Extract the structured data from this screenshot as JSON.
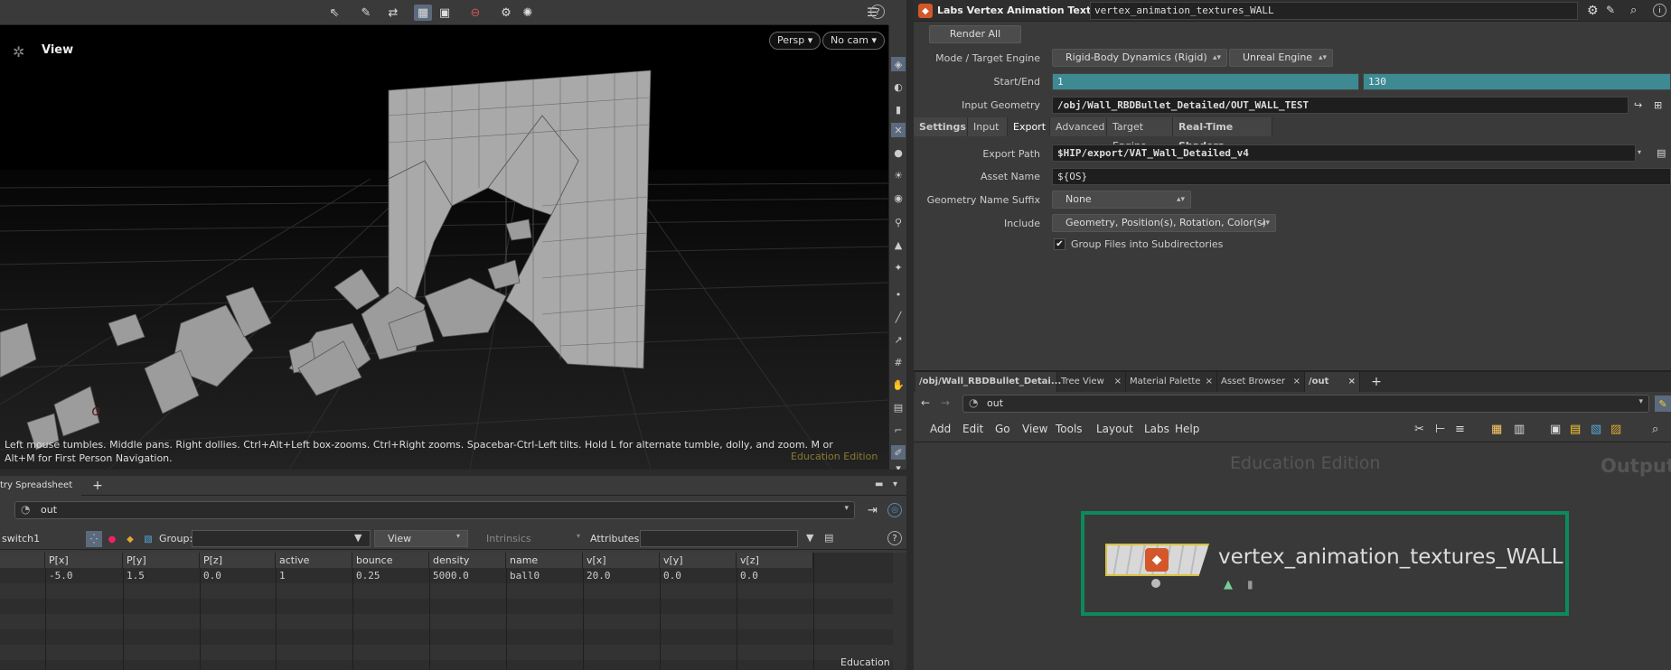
{
  "viewport": {
    "title": "View",
    "camera_persp": "Persp ▾",
    "camera_nocam": "No cam ▾",
    "hint": "Left mouse tumbles. Middle pans. Right dollies. Ctrl+Alt+Left box-zooms. Ctrl+Right zooms. Spacebar-Ctrl-Left tilts. Hold L for alternate tumble, dolly, and zoom. M or Alt+M for First Person Navigation.",
    "edition": "Education Edition",
    "help": "?"
  },
  "spreadsheet": {
    "tab_label": "try Spreadsheet",
    "add_tab": "+",
    "path": "out",
    "node": "switch1",
    "group_label": "Group:",
    "view_label": "View",
    "intrinsics_label": "Intrinsics",
    "attributes_label": "Attributes:",
    "edition": "Education",
    "columns": [
      "P[x]",
      "P[y]",
      "P[z]",
      "active",
      "bounce",
      "density",
      "name",
      "v[x]",
      "v[y]",
      "v[z]"
    ],
    "rows": [
      [
        "-5.0",
        "1.5",
        "0.0",
        "1",
        "0.25",
        "5000.0",
        "ball0",
        "20.0",
        "0.0",
        "0.0"
      ]
    ]
  },
  "params": {
    "node_type": "Labs Vertex Animation Textures",
    "node_name": "vertex_animation_textures_WALL",
    "render_all": "Render All",
    "mode_label": "Mode / Target Engine",
    "mode_value": "Rigid-Body Dynamics (Rigid)",
    "engine_value": "Unreal Engine",
    "startend_label": "Start/End",
    "start": "1",
    "end": "130",
    "input_geo_label": "Input Geometry",
    "input_geo": "/obj/Wall_RBDBullet_Detailed/OUT_WALL_TEST",
    "tabs": [
      "Settings",
      "Input",
      "Export",
      "Advanced",
      "Target Engine",
      "Real-Time Shaders"
    ],
    "export_path_label": "Export Path",
    "export_path": "$HIP/export/VAT_Wall_Detailed_v4",
    "asset_name_label": "Asset Name",
    "asset_name": "${OS}",
    "geo_suffix_label": "Geometry Name Suffix",
    "geo_suffix": "None",
    "include_label": "Include",
    "include": "Geometry, Position(s), Rotation, Color(s)",
    "group_files": "Group Files into Subdirectories",
    "group_files_checked": true
  },
  "network": {
    "tabs": [
      "/obj/Wall_RBDBullet_Detai...",
      "Tree View",
      "Material Palette",
      "Asset Browser",
      "/out"
    ],
    "add_tab": "+",
    "path": "out",
    "menu": [
      "Add",
      "Edit",
      "Go",
      "View",
      "Tools",
      "Layout",
      "Labs",
      "Help"
    ],
    "watermark": "Education Edition",
    "context_label": "Output",
    "node_name": "vertex_animation_textures_WALL",
    "accent": "#0c8a5c"
  }
}
